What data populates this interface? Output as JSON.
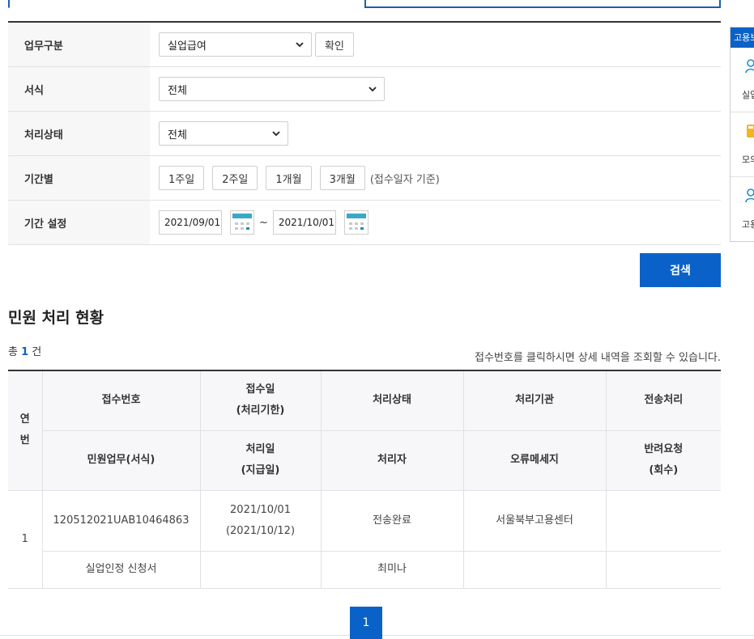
{
  "form": {
    "job_type_label": "업무구분",
    "job_type_value": "실업급여",
    "confirm_label": "확인",
    "form_label": "서식",
    "form_value": "전체",
    "status_label": "처리상태",
    "status_value": "전체",
    "period_label": "기간별",
    "period_buttons": [
      "1주일",
      "2주일",
      "1개월",
      "3개월"
    ],
    "period_hint": "(접수일자 기준)",
    "range_label": "기간 설정",
    "start_date": "2021/09/01",
    "end_date": "2021/10/01",
    "tilde": "~"
  },
  "search_label": "검색",
  "section_title": "민원 처리 현황",
  "total": {
    "prefix": "총",
    "count": "1",
    "suffix": "건"
  },
  "notice": "접수번호를 클릭하시면 상세 내역을 조회할 수 있습니다.",
  "table": {
    "header_row1": [
      "접수번호",
      "접수일\n(처리기한)",
      "처리상태",
      "처리기관",
      "전송처리"
    ],
    "header_row2": [
      "민원업무(서식)",
      "처리일\n(지급일)",
      "처리자",
      "오류메세지",
      "반려요청\n(회수)"
    ],
    "index_header": "연\n번",
    "rows": [
      {
        "index": "1",
        "receipt_no": "120512021UAB10464863",
        "receipt_date": "2021/10/01\n(2021/10/12)",
        "status": "전송완료",
        "agency": "서울북부고용센터",
        "transfer": "",
        "task": "실업인정 신청서",
        "processed_date": "",
        "handler": "최미나",
        "error": "",
        "return_req": ""
      }
    ]
  },
  "pagination": {
    "current": "1"
  },
  "float_panel": {
    "head": "고용보",
    "items": [
      {
        "label": "실업",
        "icon": "person-icon"
      },
      {
        "label": "모의",
        "icon": "calculator-icon"
      },
      {
        "label": "고용",
        "icon": "person-icon"
      }
    ]
  }
}
